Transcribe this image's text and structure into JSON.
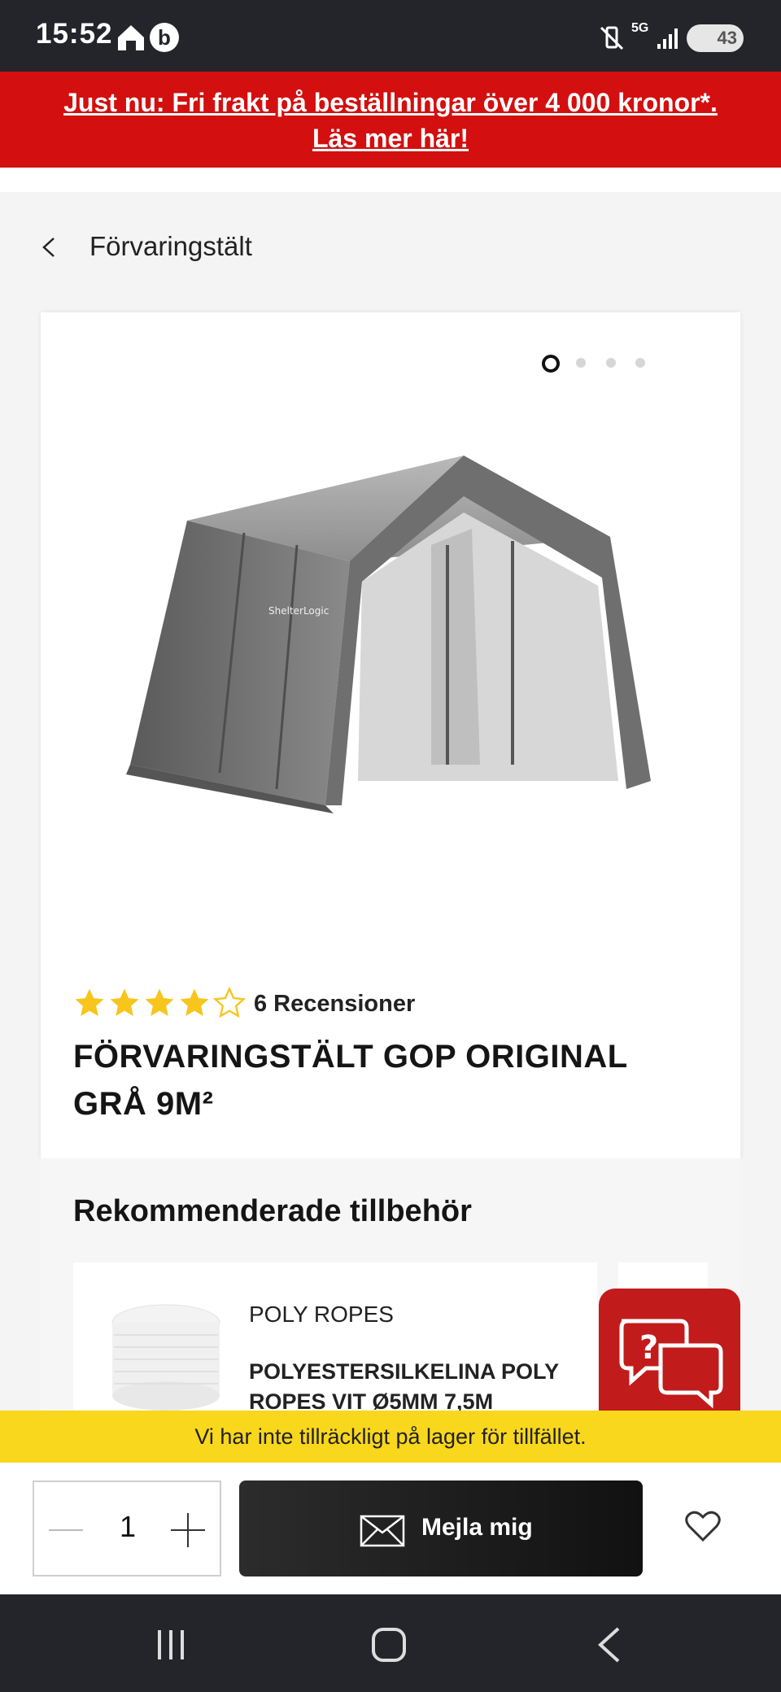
{
  "status_bar": {
    "time": "15:52",
    "network": "5G",
    "battery": "43"
  },
  "promo": {
    "line1": "Just nu: Fri frakt på beställningar över 4 000 kronor*.",
    "line2": "Läs mer här!"
  },
  "breadcrumb": {
    "label": "Förvaringstält"
  },
  "product": {
    "image_dots": 4,
    "active_dot": 1,
    "rating": 4,
    "rating_max": 5,
    "reviews": "6 Recensioner",
    "title": "FÖRVARINGSTÄLT GOP ORIGINAL GRÅ 9M²"
  },
  "recommended": {
    "heading": "Rekommenderade tillbehör",
    "items": [
      {
        "brand": "POLY ROPES",
        "name": "POLYESTERSILKELINA POLY ROPES VIT Ø5MM 7,5M"
      }
    ]
  },
  "stock_notice": "Vi har inte tillräckligt på lager för tillfället.",
  "actions": {
    "quantity": "1",
    "notify_label": "Mejla mig"
  },
  "colors": {
    "promo_red": "#d30f0f",
    "star_yellow": "#f7c51c",
    "stock_yellow": "#f9d71c",
    "chat_red": "#c21b1b"
  }
}
